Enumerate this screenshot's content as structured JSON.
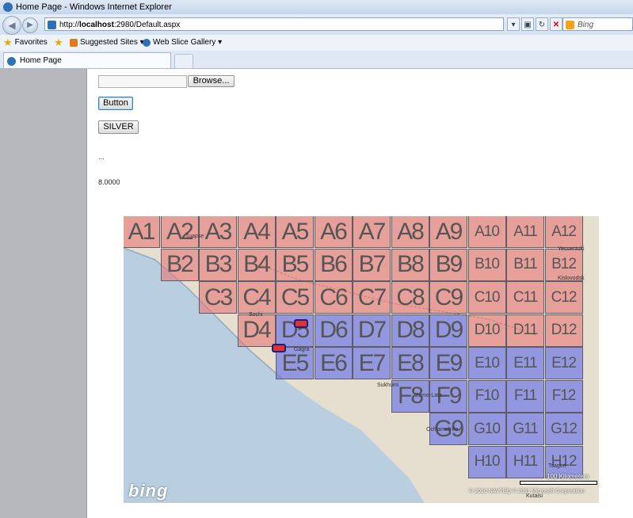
{
  "window": {
    "title": "Home Page - Windows Internet Explorer"
  },
  "address": {
    "prefix": "http://",
    "host": "localhost",
    "rest": ":2980/Default.aspx"
  },
  "search": {
    "placeholder": "Bing"
  },
  "favorites": {
    "label": "Favorites",
    "suggested": "Suggested Sites ▾",
    "webslice": "Web Slice Gallery ▾"
  },
  "tab": {
    "label": "Home Page"
  },
  "form": {
    "browse_label": "Browse...",
    "button_label": "Button",
    "silver_label": "SILVER",
    "ellipsis": "...",
    "value": "8.0000"
  },
  "map": {
    "logo": "bing",
    "scale": "100 Kilometers",
    "copyright": "© 2010 NAVTEQ  © 2011 Microsoft Corporation",
    "cells": [
      {
        "id": "A1",
        "c": "red"
      },
      {
        "id": "A2",
        "c": "red"
      },
      {
        "id": "A3",
        "c": "red"
      },
      {
        "id": "A4",
        "c": "red"
      },
      {
        "id": "A5",
        "c": "red"
      },
      {
        "id": "A6",
        "c": "red"
      },
      {
        "id": "A7",
        "c": "red"
      },
      {
        "id": "A8",
        "c": "red"
      },
      {
        "id": "A9",
        "c": "red"
      },
      {
        "id": "A10",
        "c": "red"
      },
      {
        "id": "A11",
        "c": "red"
      },
      {
        "id": "A12",
        "c": "red"
      },
      {
        "id": "B2",
        "c": "red"
      },
      {
        "id": "B3",
        "c": "red"
      },
      {
        "id": "B4",
        "c": "red"
      },
      {
        "id": "B5",
        "c": "red"
      },
      {
        "id": "B6",
        "c": "red"
      },
      {
        "id": "B7",
        "c": "red"
      },
      {
        "id": "B8",
        "c": "red"
      },
      {
        "id": "B9",
        "c": "red"
      },
      {
        "id": "B10",
        "c": "red"
      },
      {
        "id": "B11",
        "c": "red"
      },
      {
        "id": "B12",
        "c": "red"
      },
      {
        "id": "C3",
        "c": "red"
      },
      {
        "id": "C4",
        "c": "red"
      },
      {
        "id": "C5",
        "c": "red"
      },
      {
        "id": "C6",
        "c": "red"
      },
      {
        "id": "C7",
        "c": "red"
      },
      {
        "id": "C8",
        "c": "red"
      },
      {
        "id": "C9",
        "c": "red"
      },
      {
        "id": "C10",
        "c": "red"
      },
      {
        "id": "C11",
        "c": "red"
      },
      {
        "id": "C12",
        "c": "red"
      },
      {
        "id": "D4",
        "c": "red"
      },
      {
        "id": "D5",
        "c": "blue"
      },
      {
        "id": "D6",
        "c": "blue"
      },
      {
        "id": "D7",
        "c": "blue"
      },
      {
        "id": "D8",
        "c": "blue"
      },
      {
        "id": "D9",
        "c": "blue"
      },
      {
        "id": "D10",
        "c": "red"
      },
      {
        "id": "D11",
        "c": "red"
      },
      {
        "id": "D12",
        "c": "red"
      },
      {
        "id": "E5",
        "c": "blue"
      },
      {
        "id": "E6",
        "c": "blue"
      },
      {
        "id": "E7",
        "c": "blue"
      },
      {
        "id": "E8",
        "c": "blue"
      },
      {
        "id": "E9",
        "c": "blue"
      },
      {
        "id": "E10",
        "c": "blue"
      },
      {
        "id": "E11",
        "c": "blue"
      },
      {
        "id": "E12",
        "c": "blue"
      },
      {
        "id": "F8",
        "c": "blue"
      },
      {
        "id": "F9",
        "c": "blue"
      },
      {
        "id": "F10",
        "c": "blue"
      },
      {
        "id": "F11",
        "c": "blue"
      },
      {
        "id": "F12",
        "c": "blue"
      },
      {
        "id": "G9",
        "c": "blue"
      },
      {
        "id": "G10",
        "c": "blue"
      },
      {
        "id": "G11",
        "c": "blue"
      },
      {
        "id": "G12",
        "c": "blue"
      },
      {
        "id": "H10",
        "c": "blue"
      },
      {
        "id": "H11",
        "c": "blue"
      },
      {
        "id": "H12",
        "c": "blue"
      }
    ],
    "places": [
      "Tuapse",
      "Sochi",
      "Gagra",
      "Sukhumi",
      "Kislovodsk",
      "Yessentuki",
      "Zemo-Lata",
      "Och'amch'ire",
      "Kutaisi",
      "Tsageri"
    ]
  }
}
